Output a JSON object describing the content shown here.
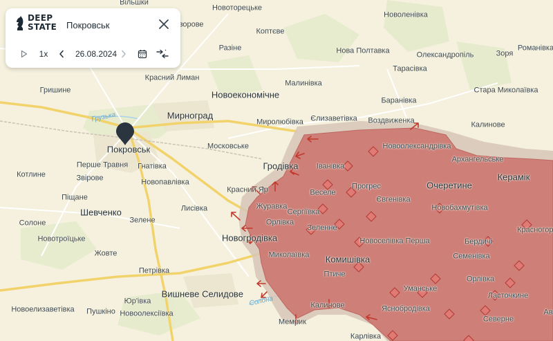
{
  "panel": {
    "logo_line1": "DEEP",
    "logo_line2": "STATE",
    "place_title": "Покровськ",
    "speed": "1x",
    "date": "26.08.2024"
  },
  "icons": [
    "play-icon",
    "chevron-left-icon",
    "chevron-right-icon",
    "calendar-icon",
    "compare-arrows-icon",
    "close-icon",
    "map-pin-icon"
  ],
  "colors": {
    "occupied": "#cc6f6a",
    "grey_zone": "#d8c8b8",
    "road": "#f2d36b",
    "water": "#a9d3ea"
  },
  "labels": {
    "pokrovsk": "Покровськ",
    "myrnohrad": "Мирноград",
    "selydove": "Селидове",
    "ocheretyne": "Очеретине",
    "hrodivka": "Гродівка",
    "komyshivka": "Комишівка",
    "novoekonomichne": "Новоекономічне",
    "krasnyi_lyman": "Красний Лиман",
    "vyshneve": "Вишневе",
    "shevchenko": "Шевченко",
    "hryshyne": "Гришине",
    "kotlyne": "Котлине",
    "pischane": "Піщане",
    "zvirove": "Звірове",
    "pershe_travnia": "Перше Травня",
    "hnativka": "Гнатівка",
    "novopavlivka": "Новопавлівка",
    "lysivka": "Лисівка",
    "zelene": "Зелене",
    "solone": "Солоне",
    "novotroitske": "Новотроїцьке",
    "zhovte": "Жовте",
    "petrivka": "Петрівка",
    "novoelyzavetivka": "Новоелизаветівка",
    "pushkino": "Пушкіно",
    "yurivka": "Юр'івка",
    "novooleksiivka": "Новоолексіївка",
    "moskovske": "Московське",
    "myroliubivka": "Миролюбівка",
    "yelyzavetivka": "Єлизаветівка",
    "vozdvyzhenka": "Воздвиженка",
    "malynivka": "Малинівка",
    "razine": "Разіне",
    "koptieve": "Коптєве",
    "novotoretske": "Новоторецьке",
    "vilyshky": "Вільшки",
    "zorove": "зорове",
    "nova_poltavka": "Нова Полтавка",
    "novolenivka": "Новоленівка",
    "oleksandropil": "Олександропіль",
    "zoria": "Зоря",
    "romanivka": "Романівка",
    "tarasivka": "Тарасівка",
    "baranivka": "Баранівка",
    "stara_mykolaivka": "Стара Миколаївка",
    "kalynove": "Калинове",
    "novooleksandrivka": "Новоолександрівка",
    "arkhanhelske": "Архангельське",
    "keramik": "Керамік",
    "ivanivka": "Іванівка",
    "prohres": "Прогрес",
    "vesele": "Веселе",
    "yevhenivka": "Євгенівка",
    "krasnyi_yar": "Красний Яр",
    "zhuravka": "Журавка",
    "serhiivka": "Сергіївка",
    "orlivka": "Орлівка",
    "novobakhmutivka": "Новобахмутівка",
    "zelenne": "Зеленне",
    "novohrodivka": "Новогродівка",
    "novoselivka_persha": "Новоселівка Перша",
    "berdychi": "Бердичі",
    "krasnohorivka": "Красногорівка",
    "mykolaivka": "Миколаївка",
    "semenivka": "Семенівка",
    "orlivka2": "Орлівка",
    "ptyche": "Птиче",
    "umanske": "Уманське",
    "lastochkyne": "Ласточкине",
    "yasnobrodivka": "Яснобродівка",
    "kalynove2": "Калинове",
    "sieverne": "Северне",
    "memryk": "Мемрик",
    "karlivka": "Карлівка",
    "river_hrushka": "Грузька",
    "river_solona": "Солона",
    "av": "Ав"
  }
}
